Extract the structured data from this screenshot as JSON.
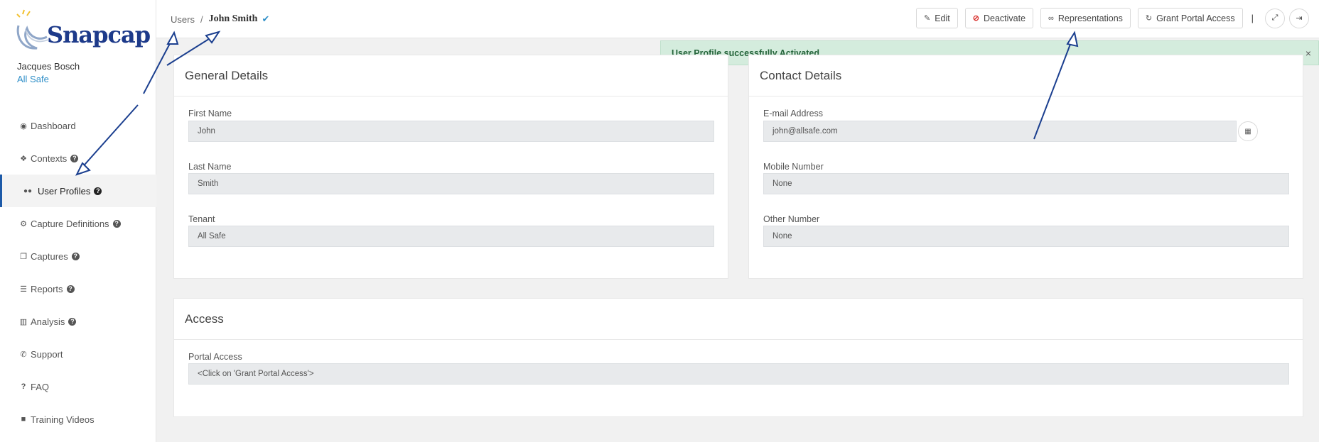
{
  "sidebar": {
    "logo_text": "Snapcap",
    "user_name": "Jacques Bosch",
    "tenant": "All Safe",
    "items": [
      {
        "label": "Dashboard",
        "icon": "dashboard-icon",
        "glyph": "◉",
        "help": false
      },
      {
        "label": "Contexts",
        "icon": "cubes-icon",
        "glyph": "❖",
        "help": true
      },
      {
        "label": "User Profiles",
        "icon": "users-icon",
        "glyph": "👥",
        "help": true,
        "active": true
      },
      {
        "label": "Capture Definitions",
        "icon": "cogs-icon",
        "glyph": "⚙",
        "help": true
      },
      {
        "label": "Captures",
        "icon": "copy-icon",
        "glyph": "❐",
        "help": true
      },
      {
        "label": "Reports",
        "icon": "list-icon",
        "glyph": "☰",
        "help": true
      },
      {
        "label": "Analysis",
        "icon": "bar-chart-icon",
        "glyph": "▥",
        "help": true
      },
      {
        "label": "Support",
        "icon": "phone-icon",
        "glyph": "✆",
        "help": false
      },
      {
        "label": "FAQ",
        "icon": "question-icon",
        "glyph": "?",
        "help": false
      },
      {
        "label": "Training Videos",
        "icon": "video-camera-icon",
        "glyph": "■",
        "help": false
      }
    ],
    "help_glyph": "?"
  },
  "header": {
    "breadcrumb_root": "Users",
    "breadcrumb_sep": "/",
    "breadcrumb_current": "John Smith",
    "verified_glyph": "✔",
    "buttons": {
      "edit": "Edit",
      "deactivate": "Deactivate",
      "representations": "Representations",
      "grant_portal_access": "Grant Portal Access"
    },
    "divider": "|"
  },
  "alert": {
    "message": "User Profile successfully Activated",
    "close": "×"
  },
  "general": {
    "title": "General Details",
    "first_name_label": "First Name",
    "first_name": "John",
    "last_name_label": "Last Name",
    "last_name": "Smith",
    "tenant_label": "Tenant",
    "tenant": "All Safe"
  },
  "contact": {
    "title": "Contact Details",
    "email_label": "E-mail Address",
    "email": "john@allsafe.com",
    "mobile_label": "Mobile Number",
    "mobile": "None",
    "other_label": "Other Number",
    "other": "None"
  },
  "access": {
    "title": "Access",
    "portal_label": "Portal Access",
    "portal": "<Click on 'Grant Portal Access'>"
  },
  "colors": {
    "accent": "#1d5aa8",
    "link": "#2f8fc8",
    "success_bg": "#d4ecdd",
    "danger": "#d9302c",
    "annotation_arrow": "#1b3f8f"
  }
}
